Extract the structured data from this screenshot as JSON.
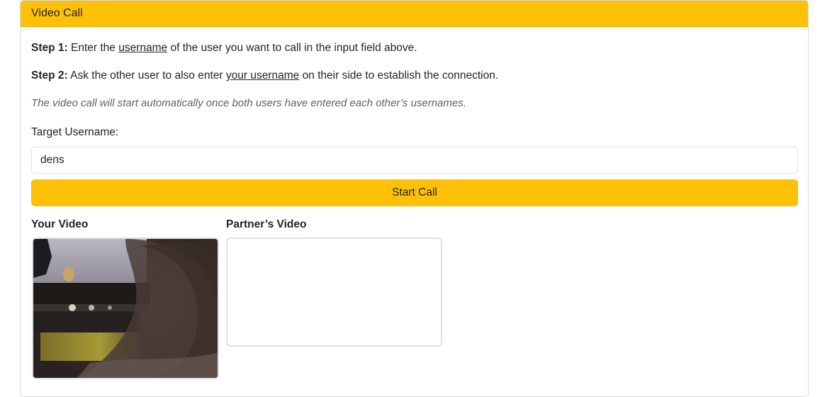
{
  "card": {
    "header_title": "Video Call"
  },
  "instructions": {
    "step1_label": "Step 1:",
    "step1_pre": "Enter the",
    "step1_link": "username",
    "step1_post": "of the user you want to call in the input field above.",
    "step2_label": "Step 2:",
    "step2_pre": "Ask the other user to also enter",
    "step2_link": "your username",
    "step2_post": "on their side to establish the connection.",
    "note": "The video call will start automatically once both users have entered each other’s usernames."
  },
  "form": {
    "target_label": "Target Username:",
    "target_value": "dens",
    "start_button_label": "Start Call"
  },
  "videos": {
    "local_title": "Your Video",
    "remote_title": "Partner’s Video"
  },
  "colors": {
    "accent": "#ffc107",
    "border": "#dee2e6"
  }
}
